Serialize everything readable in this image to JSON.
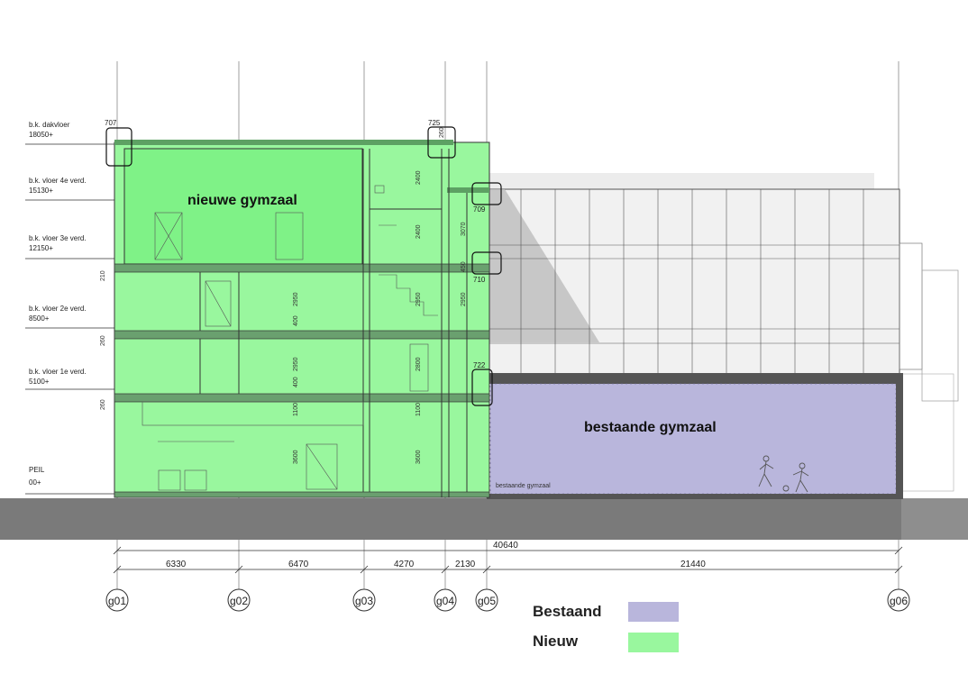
{
  "colors": {
    "existing": "#b9b6dc",
    "new": "#99f79e",
    "ground": "#7a7a7a"
  },
  "levels": [
    {
      "label": "b.k. dakvloer",
      "value": "18050+"
    },
    {
      "label": "b.k. vloer 4e verd.",
      "value": "15130+"
    },
    {
      "label": "b.k. vloer 3e verd.",
      "value": "12150+"
    },
    {
      "label": "b.k. vloer 2e verd.",
      "value": "8500+"
    },
    {
      "label": "b.k. vloer 1e verd.",
      "value": "5100+"
    },
    {
      "label": "PEIL",
      "value": "00+"
    }
  ],
  "grid_axes": [
    "g01",
    "g02",
    "g03",
    "g04",
    "g05",
    "g06"
  ],
  "dimensions": {
    "total": "40640",
    "spans": [
      "6330",
      "6470",
      "4270",
      "2130",
      "21440"
    ]
  },
  "details": [
    "707",
    "725",
    "709",
    "710",
    "722"
  ],
  "heights": [
    "260",
    "2400",
    "3070",
    "2400",
    "2950",
    "2950",
    "2950",
    "2800",
    "2950",
    "1100",
    "1100",
    "3600",
    "3600",
    "400",
    "400",
    "450",
    "210",
    "260",
    "260"
  ],
  "rooms": {
    "new_gym": "nieuwe gymzaal",
    "existing_gym": "bestaande gymzaal",
    "existing_gym_small": "bestaande gymzaal"
  },
  "legend": {
    "existing": "Bestaand",
    "new": "Nieuw"
  }
}
